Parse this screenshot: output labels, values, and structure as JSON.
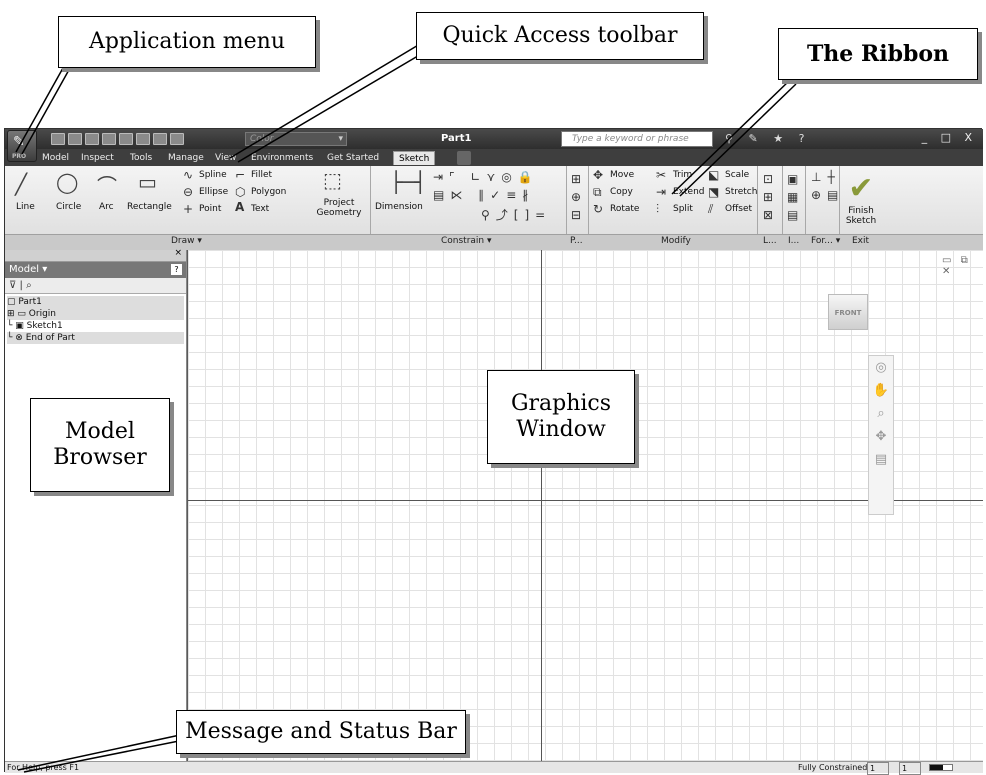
{
  "title_bar": {
    "app_badge": "PRO",
    "color_placeholder": "Color",
    "doc_title": "Part1",
    "search_placeholder": "Type a keyword or phrase",
    "window_controls": "_ □ X"
  },
  "tabs": [
    "Model",
    "Inspect",
    "Tools",
    "Manage",
    "View",
    "Environments",
    "Get Started",
    "Sketch"
  ],
  "active_tab": "Sketch",
  "ribbon": {
    "draw": {
      "line": "Line",
      "circle": "Circle",
      "arc": "Arc",
      "rectangle": "Rectangle",
      "spline": "Spline",
      "ellipse": "Ellipse",
      "point": "Point",
      "fillet": "Fillet",
      "polygon": "Polygon",
      "text": "Text",
      "project_geometry": "Project Geometry"
    },
    "constrain": {
      "dimension": "Dimension"
    },
    "modify": {
      "move": "Move",
      "copy": "Copy",
      "rotate": "Rotate",
      "trim": "Trim",
      "extend": "Extend",
      "split": "Split",
      "scale": "Scale",
      "stretch": "Stretch",
      "offset": "Offset"
    },
    "exit": {
      "finish_line1": "Finish",
      "finish_line2": "Sketch"
    },
    "panels": {
      "draw": "Draw",
      "constrain": "Constrain",
      "pattern": "P...",
      "modify": "Modify",
      "layout": "L...",
      "insert": "I...",
      "format": "For...",
      "exit": "Exit"
    }
  },
  "browser": {
    "title": "Model",
    "tree": [
      "Part1",
      "Origin",
      "Sketch1",
      "End of Part"
    ]
  },
  "graphics": {
    "viewcube": "FRONT"
  },
  "status": {
    "help": "For Help, press F1",
    "constraint": "Fully Constrained",
    "count1": "1",
    "count2": "1"
  },
  "callouts": {
    "app_menu": "Application menu",
    "qat": "Quick Access toolbar",
    "ribbon": "The Ribbon",
    "browser_l1": "Model",
    "browser_l2": "Browser",
    "graphics_l1": "Graphics",
    "graphics_l2": "Window",
    "status": "Message and Status Bar"
  }
}
